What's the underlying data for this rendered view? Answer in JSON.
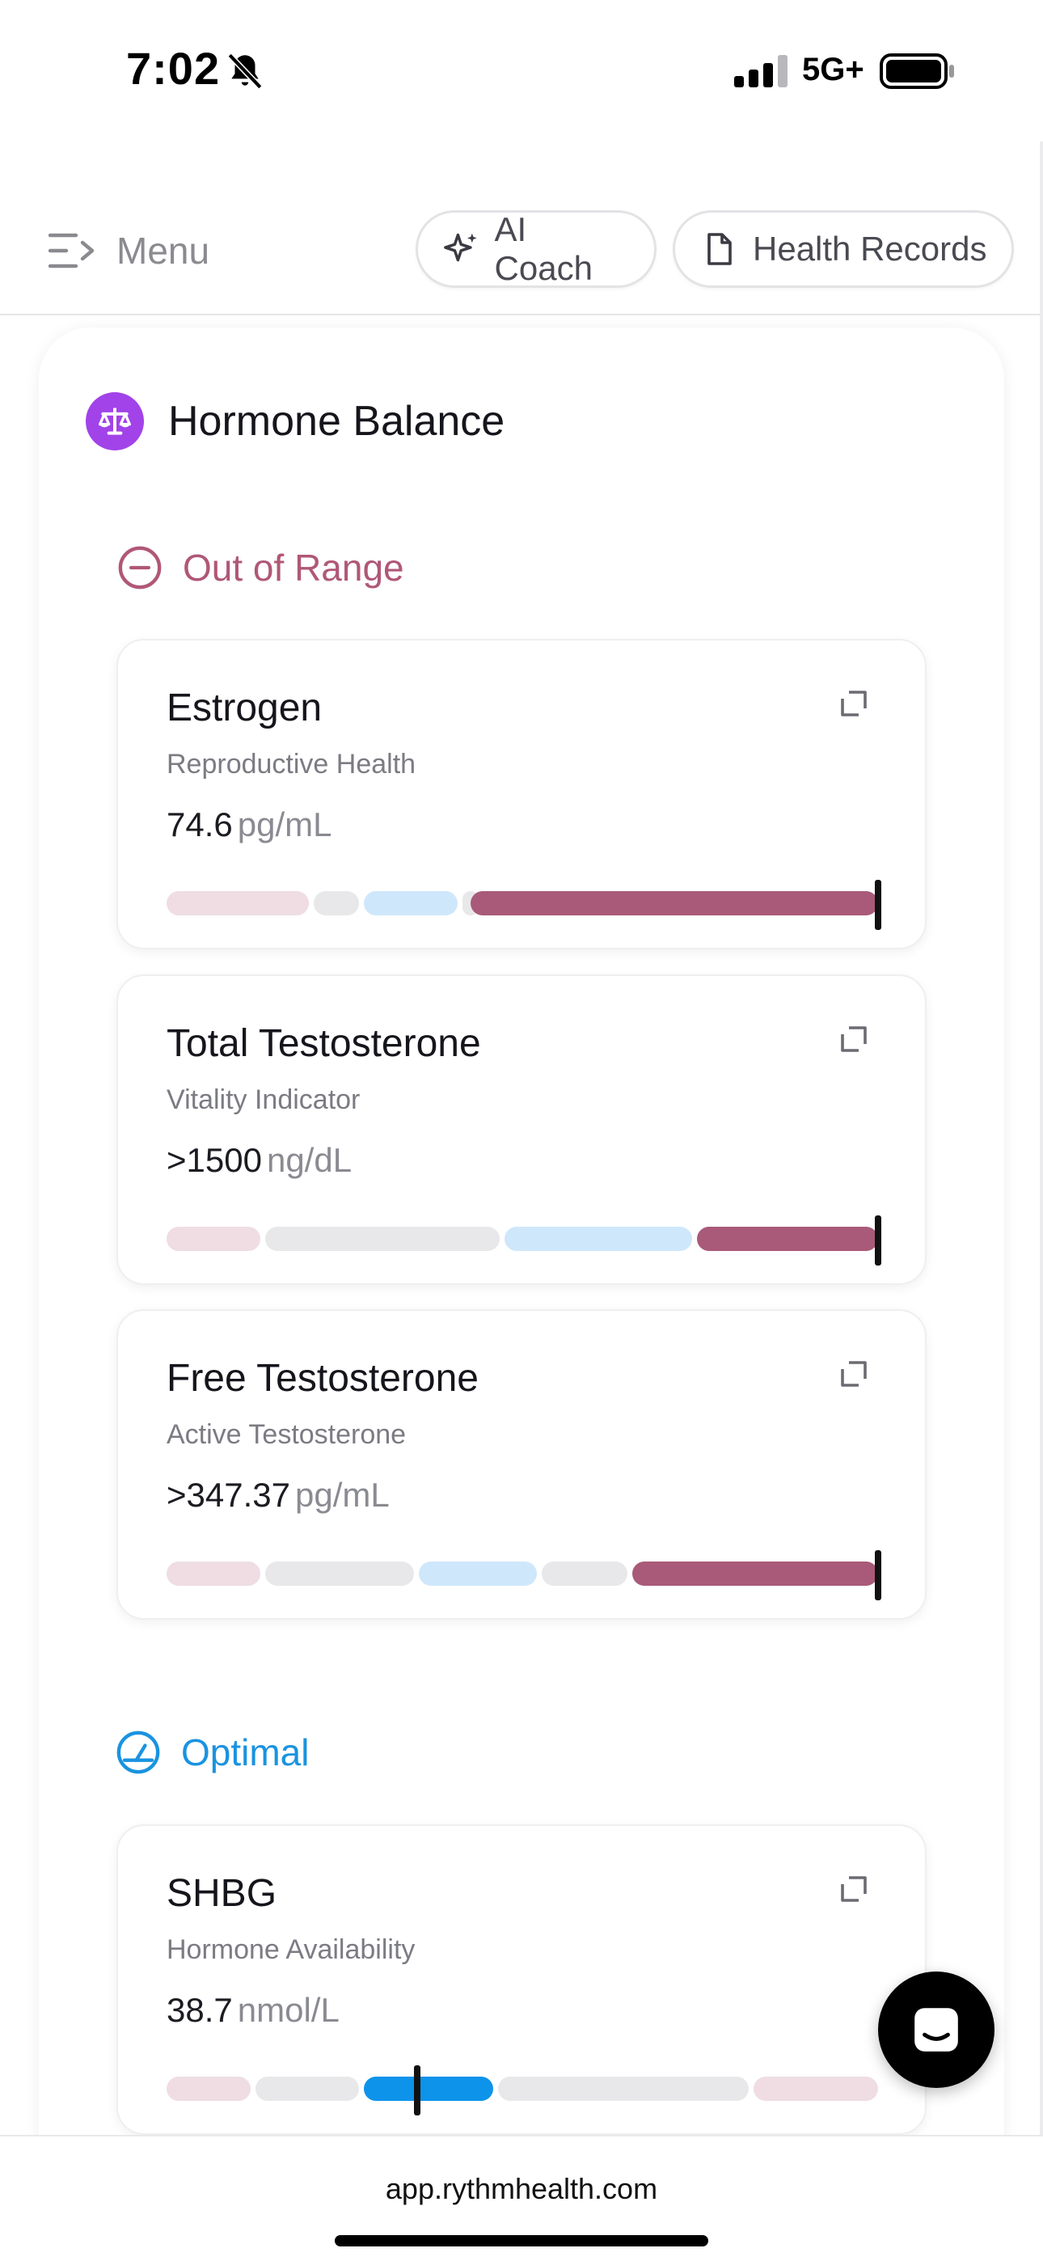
{
  "status_bar": {
    "time": "7:02",
    "network": "5G+",
    "icons": [
      "bell-slash-icon",
      "signal-icon",
      "battery-icon"
    ]
  },
  "header": {
    "menu_label": "Menu",
    "ai_coach_label": "AI Coach",
    "health_records_label": "Health Records"
  },
  "section": {
    "title": "Hormone Balance",
    "icon": "scale-icon",
    "icon_color": "#a143e8"
  },
  "groups": {
    "out_of_range": {
      "label": "Out of Range",
      "color": "#b05777"
    },
    "optimal": {
      "label": "Optimal",
      "color": "#1a93e0"
    }
  },
  "metrics": [
    {
      "name": "Estrogen",
      "subtitle": "Reproductive Health",
      "value": "74.6",
      "unit": "pg/mL",
      "status": "out_of_range",
      "marker_position": 1.0
    },
    {
      "name": "Total Testosterone",
      "subtitle": "Vitality Indicator",
      "value": ">1500",
      "unit": "ng/dL",
      "status": "out_of_range",
      "marker_position": 1.0
    },
    {
      "name": "Free Testosterone",
      "subtitle": "Active Testosterone",
      "value": ">347.37",
      "unit": "pg/mL",
      "status": "out_of_range",
      "marker_position": 1.0
    },
    {
      "name": "SHBG",
      "subtitle": "Hormone Availability",
      "value": "38.7",
      "unit": "nmol/L",
      "status": "optimal",
      "marker_position": 0.35
    }
  ],
  "range_colors": {
    "low": "#efdde3",
    "neutral": "#e8e8ea",
    "optimal_range": "#cfe7fb",
    "out_of_range_active": "#a95a78",
    "optimal_active": "#0d93ea"
  },
  "browser": {
    "url": "app.rythmhealth.com"
  }
}
